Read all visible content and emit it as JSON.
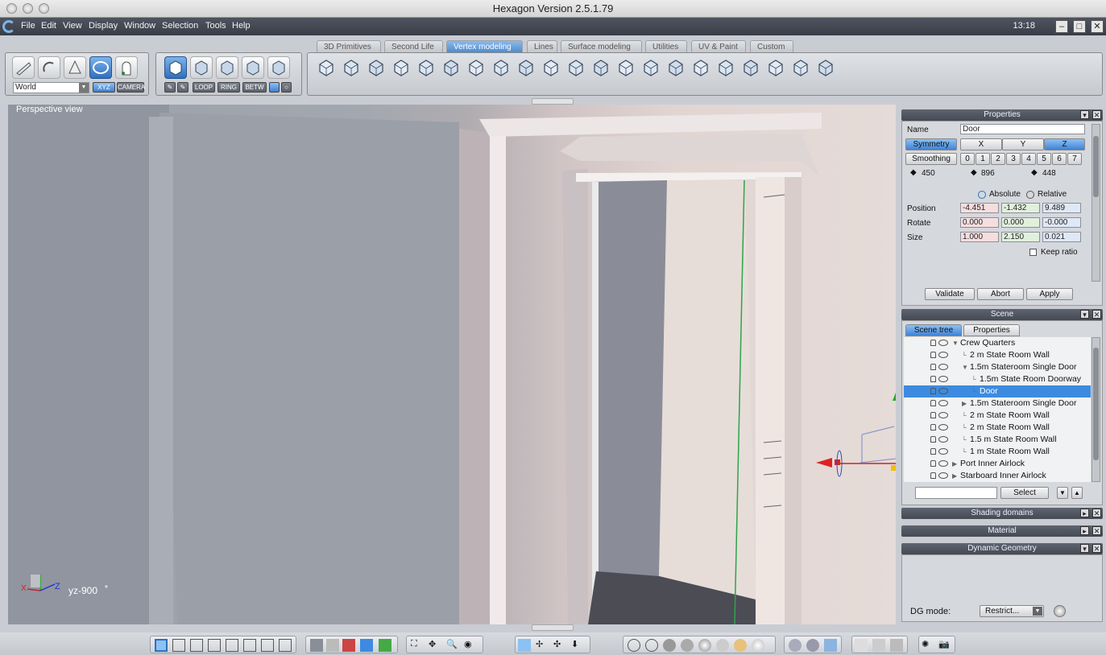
{
  "window": {
    "title": "Hexagon Version 2.5.1.79",
    "clock": "13:18"
  },
  "menu": {
    "items": [
      "File",
      "Edit",
      "View",
      "Display",
      "Window",
      "Selection",
      "Tools",
      "Help"
    ]
  },
  "tabs": [
    "3D Primitives",
    "Second Life",
    "Vertex modeling",
    "Lines",
    "Surface modeling",
    "Utilities",
    "UV & Paint",
    "Custom"
  ],
  "active_tab": "Vertex modeling",
  "left_tools": {
    "space_select": "World",
    "xyz_label": "XYZ",
    "camera_label": "CAMERA",
    "loop": "LOOP",
    "ring": "RING",
    "betw": "BETW"
  },
  "viewport": {
    "label": "Perspective view",
    "axis_x": "X",
    "axis_z": "Z",
    "view_code": "yz-900",
    "view_mark": "*"
  },
  "properties": {
    "panel_title": "Properties",
    "name_label": "Name",
    "name_value": "Door",
    "symmetry_label": "Symmetry",
    "sym_x": "X",
    "sym_y": "Y",
    "sym_z": "Z",
    "smoothing_label": "Smoothing",
    "smoothing_levels": [
      "0",
      "1",
      "2",
      "3",
      "4",
      "5",
      "6",
      "7"
    ],
    "count1": "450",
    "count2": "896",
    "count3": "448",
    "absolute_label": "Absolute",
    "relative_label": "Relative",
    "position_label": "Position",
    "position": [
      "-4.451",
      "-1.432",
      "9.489"
    ],
    "rotate_label": "Rotate",
    "rotate": [
      "0.000",
      "0.000",
      "-0.000"
    ],
    "size_label": "Size",
    "size": [
      "1.000",
      "2.150",
      "0.021"
    ],
    "keep_ratio_label": "Keep ratio",
    "validate": "Validate",
    "abort": "Abort",
    "apply": "Apply"
  },
  "scene": {
    "panel_title": "Scene",
    "tab_tree": "Scene tree",
    "tab_props": "Properties",
    "rows": [
      {
        "label": "Crew Quarters"
      },
      {
        "label": "2 m State Room Wall"
      },
      {
        "label": "1.5m Stateroom Single Door"
      },
      {
        "label": "1.5m State Room Doorway"
      },
      {
        "label": "Door"
      },
      {
        "label": "1.5m Stateroom Single Door"
      },
      {
        "label": "2 m State Room Wall"
      },
      {
        "label": "2 m State Room Wall"
      },
      {
        "label": "1.5 m State Room Wall"
      },
      {
        "label": "1 m State Room Wall"
      },
      {
        "label": "Port Inner Airlock"
      },
      {
        "label": "Starboard Inner Airlock"
      }
    ],
    "select_button": "Select",
    "search_value": ""
  },
  "shading": {
    "title": "Shading domains"
  },
  "material": {
    "title": "Material"
  },
  "dyngeo": {
    "title": "Dynamic Geometry",
    "mode_label": "DG mode:",
    "mode_value": "Restrict..."
  },
  "colors": {
    "accent": "#3d8be0",
    "menubar": "#3f434c",
    "selection": "#3d8be0"
  }
}
